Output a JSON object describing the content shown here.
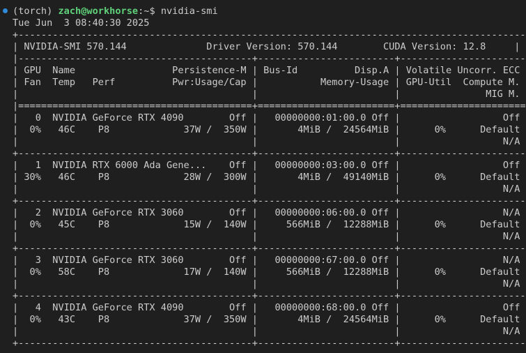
{
  "terminal": {
    "prompt": {
      "env": "(torch) ",
      "user_host": "zach@workhorse",
      "path_suffix": ":~",
      "symbol": "$ ",
      "command": "nvidia-smi"
    },
    "date_line": "Tue Jun  3 08:40:30 2025"
  },
  "smi": {
    "border_top": "+-----------------------------------------------------------------------------------------+",
    "header_line": "| NVIDIA-SMI 570.144              Driver Version: 570.144        CUDA Version: 12.8     |",
    "divider": "|-----------------------------------------+------------------------+----------------------+",
    "col_header_1": "| GPU  Name                 Persistence-M | Bus-Id          Disp.A | Volatile Uncorr. ECC |",
    "col_header_2": "| Fan  Temp   Perf          Pwr:Usage/Cap |           Memory-Usage | GPU-Util  Compute M. |",
    "col_header_3": "|                                         |                        |               MIG M. |",
    "double_divider": "|=========================================+========================+======================|",
    "row_sep": "+-----------------------------------------+------------------------+----------------------+",
    "gpus": [
      {
        "line1": "|   0  NVIDIA GeForce RTX 4090        Off |   00000000:01:00.0 Off |                  Off |",
        "line2": "|  0%   46C    P8             37W /  350W |       4MiB /  24564MiB |      0%      Default |",
        "line3": "|                                         |                        |                  N/A |"
      },
      {
        "line1": "|   1  NVIDIA RTX 6000 Ada Gene...    Off |   00000000:03:00.0 Off |                  Off |",
        "line2": "| 30%   46C    P8             28W /  300W |       4MiB /  49140MiB |      0%      Default |",
        "line3": "|                                         |                        |                  N/A |"
      },
      {
        "line1": "|   2  NVIDIA GeForce RTX 3060        Off |   00000000:06:00.0 Off |                  N/A |",
        "line2": "|  0%   45C    P8             15W /  140W |     566MiB /  12288MiB |      0%      Default |",
        "line3": "|                                         |                        |                  N/A |"
      },
      {
        "line1": "|   3  NVIDIA GeForce RTX 3060        Off |   00000000:67:00.0 Off |                  N/A |",
        "line2": "|  0%   58C    P8             17W /  140W |     566MiB /  12288MiB |      0%      Default |",
        "line3": "|                                         |                        |                  N/A |"
      },
      {
        "line1": "|   4  NVIDIA GeForce RTX 4090        Off |   00000000:68:00.0 Off |                  Off |",
        "line2": "|  0%   43C    P8             37W /  350W |       4MiB /  24564MiB |      0%      Default |",
        "line3": "|                                         |                        |                  N/A |"
      }
    ]
  }
}
